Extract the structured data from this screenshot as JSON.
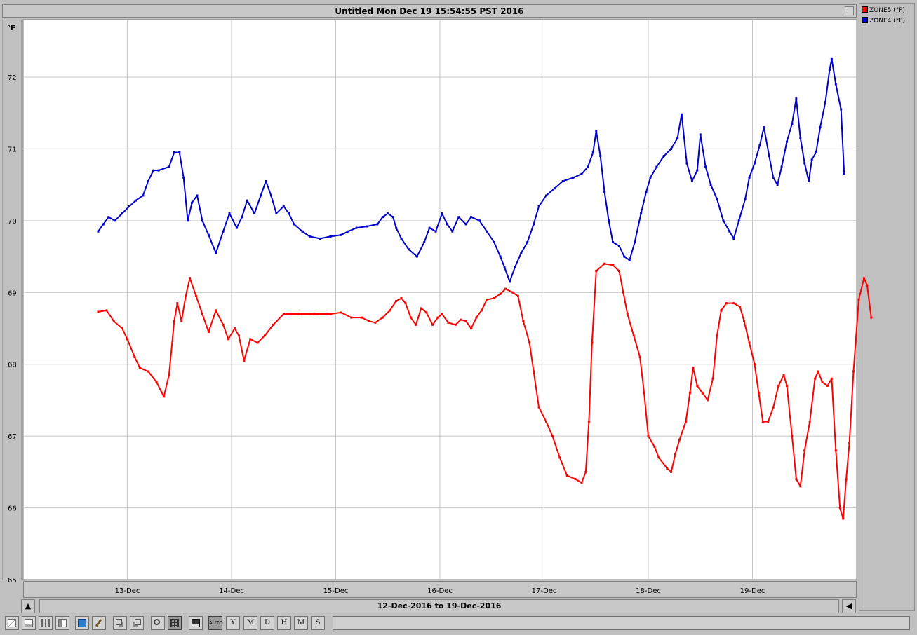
{
  "window": {
    "title": "Untitled Mon Dec 19 15:54:55 PST 2016"
  },
  "range": {
    "label": "12-Dec-2016 to 19-Dec-2016"
  },
  "toolbar": {
    "buttons": [
      {
        "name": "line-chart-icon",
        "label": ""
      },
      {
        "name": "area-chart-icon",
        "label": ""
      },
      {
        "name": "bar-chart-icon",
        "label": ""
      },
      {
        "name": "grouped-bar-icon",
        "label": ""
      },
      {
        "name": "3d-box-icon",
        "label": ""
      },
      {
        "name": "brush-icon",
        "label": ""
      },
      {
        "name": "copy-icon",
        "label": ""
      },
      {
        "name": "paste-icon",
        "label": ""
      },
      {
        "name": "zoom-icon",
        "label": ""
      },
      {
        "name": "grid-icon",
        "label": ""
      },
      {
        "name": "save-icon",
        "label": ""
      },
      {
        "name": "auto-button",
        "label": "AUTO"
      },
      {
        "name": "year-button",
        "label": "Y"
      },
      {
        "name": "month-button",
        "label": "M"
      },
      {
        "name": "day-button",
        "label": "D"
      },
      {
        "name": "hour-button",
        "label": "H"
      },
      {
        "name": "minute-button",
        "label": "M"
      },
      {
        "name": "second-button",
        "label": "S"
      }
    ]
  },
  "colors": {
    "zone5": "#ff0000",
    "zone4": "#0000cc",
    "grid": "#c4c4c4",
    "plot_bg": "#ffffff"
  },
  "chart_data": {
    "type": "line",
    "title": "Untitled Mon Dec 19 15:54:55 PST 2016",
    "ylabel": "°F",
    "xlabel": "",
    "ylim": [
      65,
      72.8
    ],
    "yticks": [
      65,
      66,
      67,
      68,
      69,
      70,
      71,
      72
    ],
    "xlim": [
      12.0,
      20.0
    ],
    "xticks": [
      {
        "x": 13,
        "label": "13-Dec"
      },
      {
        "x": 14,
        "label": "14-Dec"
      },
      {
        "x": 15,
        "label": "15-Dec"
      },
      {
        "x": 16,
        "label": "16-Dec"
      },
      {
        "x": 17,
        "label": "17-Dec"
      },
      {
        "x": 18,
        "label": "18-Dec"
      },
      {
        "x": 19,
        "label": "19-Dec"
      }
    ],
    "grid": true,
    "legend": "right",
    "series": [
      {
        "name": "ZONE5 (°F)",
        "color": "#ff0000",
        "points": [
          [
            12.72,
            68.73
          ],
          [
            12.8,
            68.75
          ],
          [
            12.87,
            68.6
          ],
          [
            12.95,
            68.5
          ],
          [
            13.0,
            68.35
          ],
          [
            13.07,
            68.1
          ],
          [
            13.12,
            67.95
          ],
          [
            13.2,
            67.9
          ],
          [
            13.28,
            67.75
          ],
          [
            13.35,
            67.55
          ],
          [
            13.4,
            67.85
          ],
          [
            13.45,
            68.6
          ],
          [
            13.48,
            68.85
          ],
          [
            13.52,
            68.6
          ],
          [
            13.56,
            68.95
          ],
          [
            13.6,
            69.2
          ],
          [
            13.66,
            68.95
          ],
          [
            13.72,
            68.7
          ],
          [
            13.78,
            68.45
          ],
          [
            13.85,
            68.75
          ],
          [
            13.92,
            68.55
          ],
          [
            13.97,
            68.35
          ],
          [
            14.03,
            68.5
          ],
          [
            14.07,
            68.4
          ],
          [
            14.12,
            68.05
          ],
          [
            14.18,
            68.35
          ],
          [
            14.25,
            68.3
          ],
          [
            14.32,
            68.4
          ],
          [
            14.4,
            68.55
          ],
          [
            14.5,
            68.7
          ],
          [
            14.65,
            68.7
          ],
          [
            14.8,
            68.7
          ],
          [
            14.95,
            68.7
          ],
          [
            15.05,
            68.72
          ],
          [
            15.15,
            68.65
          ],
          [
            15.25,
            68.65
          ],
          [
            15.32,
            68.6
          ],
          [
            15.38,
            68.58
          ],
          [
            15.45,
            68.65
          ],
          [
            15.52,
            68.75
          ],
          [
            15.58,
            68.88
          ],
          [
            15.63,
            68.92
          ],
          [
            15.67,
            68.85
          ],
          [
            15.72,
            68.65
          ],
          [
            15.77,
            68.55
          ],
          [
            15.82,
            68.78
          ],
          [
            15.87,
            68.72
          ],
          [
            15.93,
            68.55
          ],
          [
            15.98,
            68.65
          ],
          [
            16.02,
            68.7
          ],
          [
            16.08,
            68.58
          ],
          [
            16.15,
            68.55
          ],
          [
            16.2,
            68.62
          ],
          [
            16.25,
            68.6
          ],
          [
            16.3,
            68.5
          ],
          [
            16.35,
            68.65
          ],
          [
            16.4,
            68.75
          ],
          [
            16.45,
            68.9
          ],
          [
            16.52,
            68.92
          ],
          [
            16.58,
            68.98
          ],
          [
            16.63,
            69.05
          ],
          [
            16.7,
            69.0
          ],
          [
            16.75,
            68.95
          ],
          [
            16.8,
            68.6
          ],
          [
            16.86,
            68.3
          ],
          [
            16.9,
            67.9
          ],
          [
            16.95,
            67.4
          ],
          [
            17.02,
            67.2
          ],
          [
            17.08,
            67.0
          ],
          [
            17.15,
            66.7
          ],
          [
            17.22,
            66.45
          ],
          [
            17.3,
            66.4
          ],
          [
            17.36,
            66.35
          ],
          [
            17.4,
            66.5
          ],
          [
            17.43,
            67.2
          ],
          [
            17.46,
            68.3
          ],
          [
            17.5,
            69.3
          ],
          [
            17.58,
            69.4
          ],
          [
            17.66,
            69.38
          ],
          [
            17.72,
            69.3
          ],
          [
            17.76,
            69.0
          ],
          [
            17.8,
            68.7
          ],
          [
            17.86,
            68.4
          ],
          [
            17.92,
            68.1
          ],
          [
            17.96,
            67.6
          ],
          [
            18.0,
            67.0
          ],
          [
            18.06,
            66.85
          ],
          [
            18.1,
            66.7
          ],
          [
            18.18,
            66.55
          ],
          [
            18.22,
            66.5
          ],
          [
            18.26,
            66.75
          ],
          [
            18.3,
            66.95
          ],
          [
            18.36,
            67.2
          ],
          [
            18.4,
            67.6
          ],
          [
            18.43,
            67.95
          ],
          [
            18.47,
            67.7
          ],
          [
            18.52,
            67.6
          ],
          [
            18.57,
            67.5
          ],
          [
            18.62,
            67.8
          ],
          [
            18.66,
            68.4
          ],
          [
            18.7,
            68.75
          ],
          [
            18.75,
            68.85
          ],
          [
            18.82,
            68.85
          ],
          [
            18.88,
            68.8
          ],
          [
            18.92,
            68.6
          ],
          [
            18.97,
            68.3
          ],
          [
            19.02,
            68.0
          ],
          [
            19.06,
            67.6
          ],
          [
            19.1,
            67.2
          ],
          [
            19.15,
            67.2
          ],
          [
            19.2,
            67.4
          ],
          [
            19.25,
            67.7
          ],
          [
            19.3,
            67.85
          ],
          [
            19.33,
            67.7
          ],
          [
            19.38,
            67.0
          ],
          [
            19.42,
            66.4
          ],
          [
            19.46,
            66.3
          ],
          [
            19.5,
            66.8
          ],
          [
            19.55,
            67.2
          ],
          [
            19.6,
            67.8
          ],
          [
            19.63,
            67.9
          ],
          [
            19.67,
            67.75
          ],
          [
            19.72,
            67.7
          ],
          [
            19.76,
            67.8
          ],
          [
            19.8,
            66.8
          ],
          [
            19.84,
            66.0
          ],
          [
            19.87,
            65.85
          ],
          [
            19.9,
            66.4
          ],
          [
            19.93,
            66.9
          ],
          [
            19.97,
            67.9
          ],
          [
            20.02,
            68.9
          ],
          [
            20.07,
            69.2
          ],
          [
            20.1,
            69.1
          ],
          [
            20.14,
            68.65
          ]
        ]
      },
      {
        "name": "ZONE4 (°F)",
        "color": "#0000cc",
        "points": [
          [
            12.72,
            69.85
          ],
          [
            12.77,
            69.95
          ],
          [
            12.82,
            70.05
          ],
          [
            12.88,
            70.0
          ],
          [
            12.95,
            70.1
          ],
          [
            13.02,
            70.2
          ],
          [
            13.08,
            70.28
          ],
          [
            13.15,
            70.35
          ],
          [
            13.2,
            70.55
          ],
          [
            13.25,
            70.7
          ],
          [
            13.3,
            70.7
          ],
          [
            13.4,
            70.75
          ],
          [
            13.45,
            70.95
          ],
          [
            13.5,
            70.95
          ],
          [
            13.54,
            70.6
          ],
          [
            13.58,
            70.0
          ],
          [
            13.62,
            70.25
          ],
          [
            13.67,
            70.35
          ],
          [
            13.72,
            70.0
          ],
          [
            13.78,
            69.8
          ],
          [
            13.85,
            69.55
          ],
          [
            13.92,
            69.85
          ],
          [
            13.98,
            70.1
          ],
          [
            14.05,
            69.9
          ],
          [
            14.1,
            70.05
          ],
          [
            14.15,
            70.28
          ],
          [
            14.22,
            70.1
          ],
          [
            14.28,
            70.35
          ],
          [
            14.33,
            70.55
          ],
          [
            14.38,
            70.35
          ],
          [
            14.43,
            70.1
          ],
          [
            14.5,
            70.2
          ],
          [
            14.55,
            70.1
          ],
          [
            14.6,
            69.95
          ],
          [
            14.68,
            69.85
          ],
          [
            14.75,
            69.78
          ],
          [
            14.85,
            69.75
          ],
          [
            14.95,
            69.78
          ],
          [
            15.05,
            69.8
          ],
          [
            15.12,
            69.85
          ],
          [
            15.2,
            69.9
          ],
          [
            15.3,
            69.92
          ],
          [
            15.4,
            69.95
          ],
          [
            15.45,
            70.05
          ],
          [
            15.5,
            70.1
          ],
          [
            15.55,
            70.05
          ],
          [
            15.58,
            69.9
          ],
          [
            15.63,
            69.75
          ],
          [
            15.7,
            69.6
          ],
          [
            15.78,
            69.5
          ],
          [
            15.85,
            69.7
          ],
          [
            15.9,
            69.9
          ],
          [
            15.96,
            69.85
          ],
          [
            16.02,
            70.1
          ],
          [
            16.07,
            69.95
          ],
          [
            16.12,
            69.85
          ],
          [
            16.18,
            70.05
          ],
          [
            16.25,
            69.95
          ],
          [
            16.3,
            70.05
          ],
          [
            16.38,
            70.0
          ],
          [
            16.45,
            69.85
          ],
          [
            16.52,
            69.7
          ],
          [
            16.58,
            69.5
          ],
          [
            16.62,
            69.35
          ],
          [
            16.67,
            69.15
          ],
          [
            16.72,
            69.35
          ],
          [
            16.78,
            69.55
          ],
          [
            16.84,
            69.7
          ],
          [
            16.9,
            69.95
          ],
          [
            16.95,
            70.2
          ],
          [
            17.02,
            70.35
          ],
          [
            17.1,
            70.45
          ],
          [
            17.18,
            70.55
          ],
          [
            17.28,
            70.6
          ],
          [
            17.36,
            70.65
          ],
          [
            17.42,
            70.75
          ],
          [
            17.47,
            70.95
          ],
          [
            17.5,
            71.25
          ],
          [
            17.54,
            70.9
          ],
          [
            17.58,
            70.4
          ],
          [
            17.62,
            70.0
          ],
          [
            17.66,
            69.7
          ],
          [
            17.72,
            69.65
          ],
          [
            17.77,
            69.5
          ],
          [
            17.82,
            69.45
          ],
          [
            17.87,
            69.7
          ],
          [
            17.93,
            70.1
          ],
          [
            17.98,
            70.4
          ],
          [
            18.02,
            70.6
          ],
          [
            18.08,
            70.75
          ],
          [
            18.15,
            70.9
          ],
          [
            18.22,
            71.0
          ],
          [
            18.28,
            71.15
          ],
          [
            18.32,
            71.48
          ],
          [
            18.37,
            70.8
          ],
          [
            18.42,
            70.55
          ],
          [
            18.47,
            70.7
          ],
          [
            18.5,
            71.2
          ],
          [
            18.55,
            70.75
          ],
          [
            18.6,
            70.5
          ],
          [
            18.66,
            70.3
          ],
          [
            18.72,
            70.0
          ],
          [
            18.78,
            69.85
          ],
          [
            18.82,
            69.75
          ],
          [
            18.87,
            70.0
          ],
          [
            18.93,
            70.3
          ],
          [
            18.97,
            70.6
          ],
          [
            19.02,
            70.8
          ],
          [
            19.07,
            71.05
          ],
          [
            19.11,
            71.3
          ],
          [
            19.16,
            70.9
          ],
          [
            19.2,
            70.6
          ],
          [
            19.24,
            70.5
          ],
          [
            19.28,
            70.75
          ],
          [
            19.33,
            71.1
          ],
          [
            19.38,
            71.35
          ],
          [
            19.42,
            71.7
          ],
          [
            19.46,
            71.15
          ],
          [
            19.5,
            70.8
          ],
          [
            19.54,
            70.55
          ],
          [
            19.57,
            70.85
          ],
          [
            19.61,
            70.95
          ],
          [
            19.65,
            71.3
          ],
          [
            19.7,
            71.65
          ],
          [
            19.74,
            72.1
          ],
          [
            19.76,
            72.25
          ],
          [
            19.8,
            71.9
          ],
          [
            19.85,
            71.55
          ],
          [
            19.88,
            70.65
          ]
        ]
      }
    ]
  }
}
